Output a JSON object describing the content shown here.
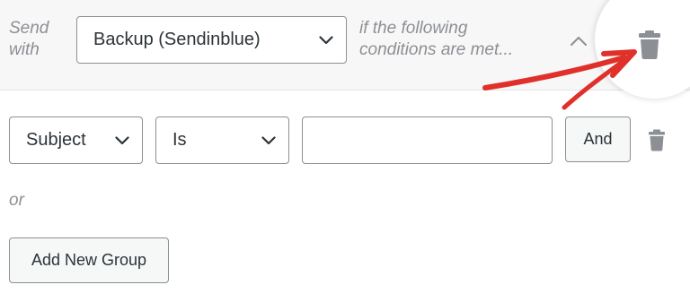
{
  "header": {
    "send_with_line1": "Send",
    "send_with_line2": "with",
    "connection_select": "Backup (Sendinblue)",
    "conditions_line1": "if the following",
    "conditions_line2": "conditions are met..."
  },
  "rule": {
    "field_select": "Subject",
    "operator_select": "Is",
    "value_input": "",
    "and_label": "And"
  },
  "or_label": "or",
  "add_group_label": "Add New Group",
  "icons": {
    "collapse": "chevron-up-icon",
    "delete_group": "trash-icon",
    "delete_rule": "trash-icon",
    "annotation": "red-arrow-icon"
  },
  "colors": {
    "annotation_red": "#e0302a",
    "icon_gray": "#8c8f94",
    "header_bg": "#f7f7f7"
  }
}
